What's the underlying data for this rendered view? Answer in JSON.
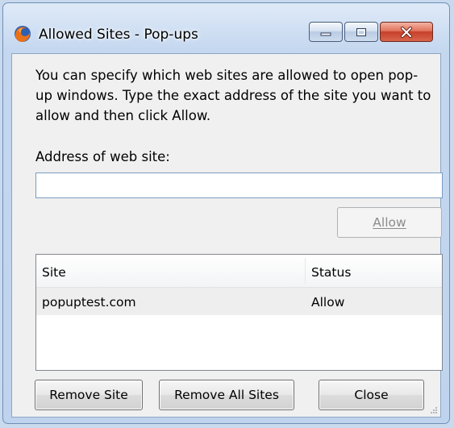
{
  "window": {
    "title": "Allowed Sites - Pop-ups",
    "app_icon": "firefox-icon"
  },
  "dialog": {
    "intro": "You can specify which web sites are allowed to open pop-up windows. Type the exact address of the site you want to allow and then click Allow.",
    "address_label": "Address of web site:",
    "address_value": "",
    "allow_label": "Allow"
  },
  "list": {
    "columns": {
      "site": "Site",
      "status": "Status"
    },
    "rows": [
      {
        "site": "popuptest.com",
        "status": "Allow"
      }
    ]
  },
  "buttons": {
    "remove_site": "Remove Site",
    "remove_all_sites": "Remove All Sites",
    "close": "Close"
  },
  "colors": {
    "frame": "#c4d7ef",
    "close_button": "#c7402a",
    "row_highlight": "#eeeeee"
  }
}
